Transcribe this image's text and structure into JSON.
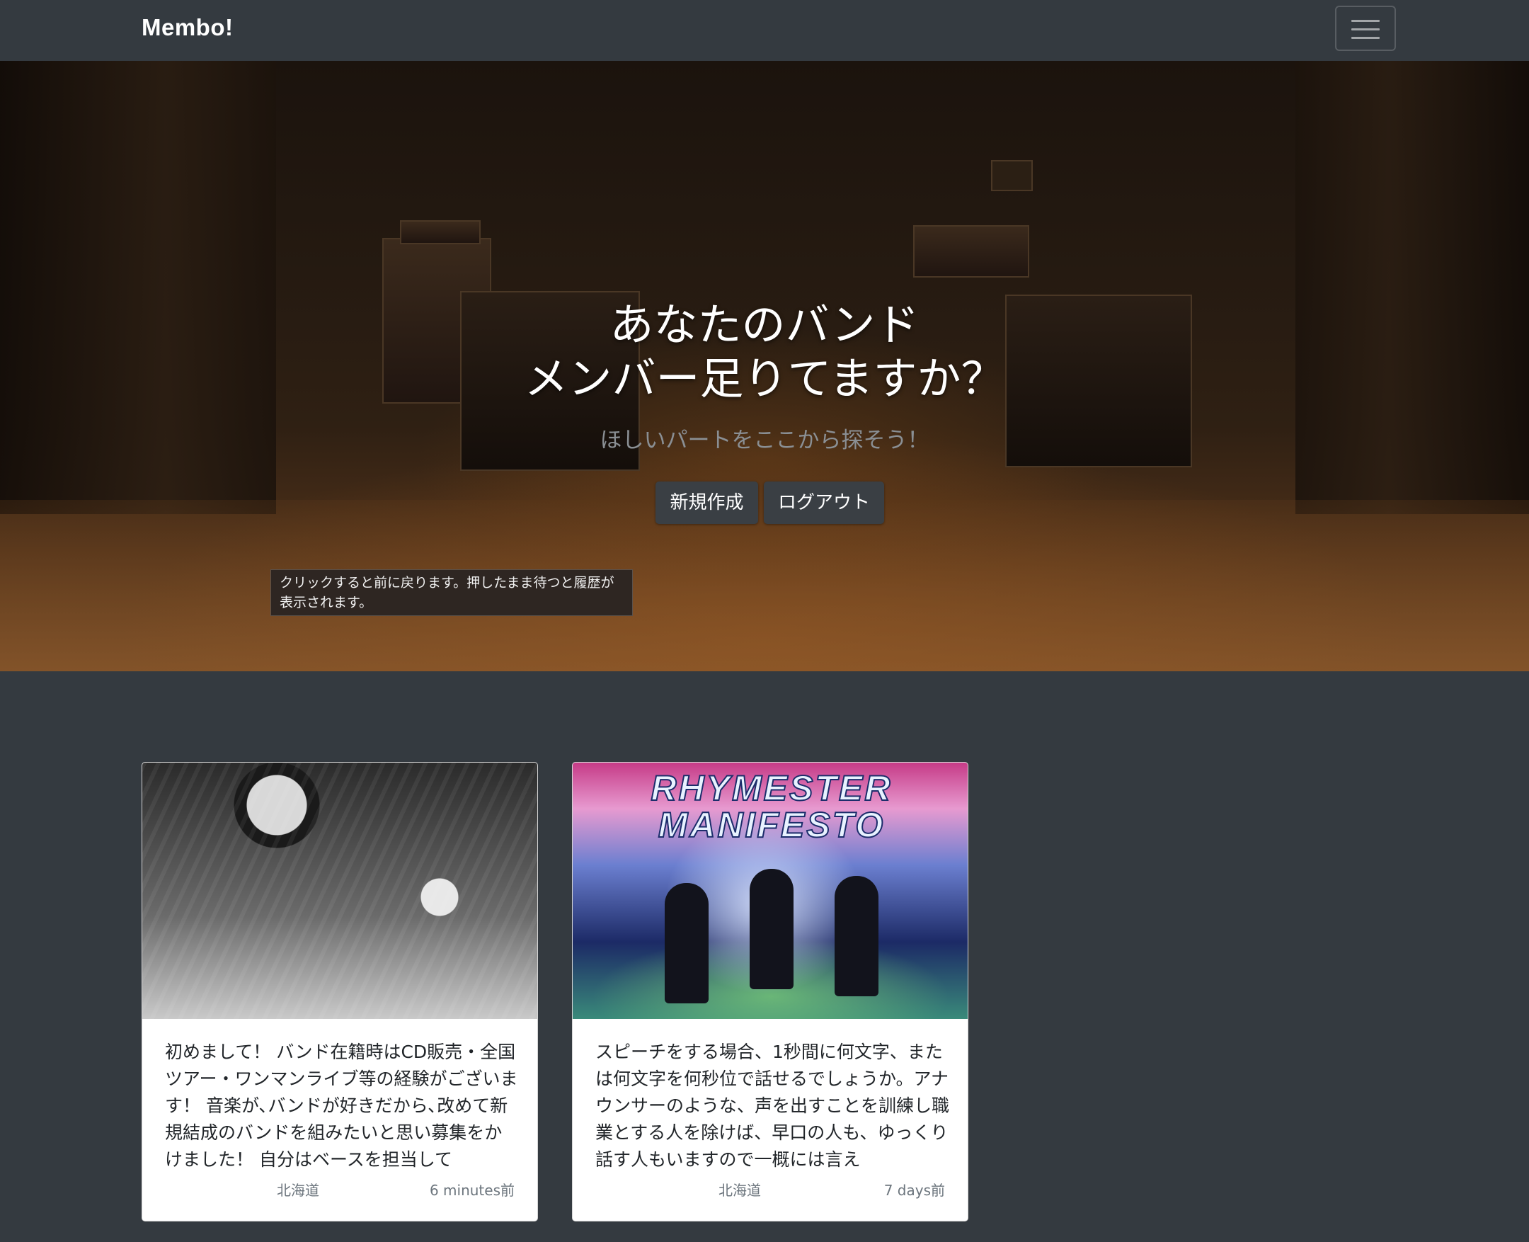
{
  "navbar": {
    "brand": "Membo!",
    "menu_icon": "hamburger-menu-icon"
  },
  "hero": {
    "title_line1": "あなたのバンド",
    "title_line2": "メンバー足りてますか？",
    "subtitle": "ほしいパートをここから探そう！",
    "new_button": "新規作成",
    "logout_button": "ログアウト"
  },
  "tooltip": {
    "text": "クリックすると前に戻ります。押したまま待つと履歴が表示されます。"
  },
  "posts": [
    {
      "body": "初めまして！ バンド在籍時はCD販売・全国ツアー・ワンマンライブ等の経験がございます！ 音楽が､バンドが好きだから､改めて新規結成のバンドを組みたいと思い募集をかけました！ 自分はベースを担当して",
      "region": "北海道",
      "time": "6 minutes前"
    },
    {
      "image_text_line1": "RHYMESTER",
      "image_text_line2": "MANIFESTO",
      "body": "スピーチをする場合、1秒間に何文字、または何文字を何秒位で話せるでしょうか。アナウンサーのような、声を出すことを訓練し職業とする人を除けば、早口の人も、ゆっくり話す人もいますので一概には言え",
      "region": "北海道",
      "time": "7 days前"
    }
  ],
  "colors": {
    "navbar_bg": "#343a40",
    "page_bg": "#343a40",
    "button_bg": "#3a3f44",
    "card_bg": "#ffffff",
    "muted_text": "#6c757d"
  }
}
